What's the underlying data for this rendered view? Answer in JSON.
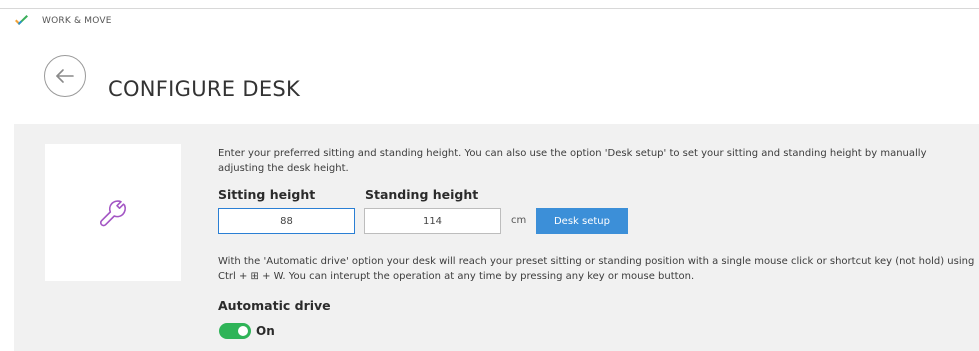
{
  "app": {
    "name": "WORK & MOVE",
    "logo_icon": "checkmark-logo-icon"
  },
  "header": {
    "back_icon": "arrow-left-icon",
    "title": "CONFIGURE DESK"
  },
  "panel": {
    "tool_icon": "wrench-icon",
    "description": "Enter your preferred sitting and standing height. You can also use the option 'Desk setup' to set your sitting and standing height by manually adjusting the desk height.",
    "sitting": {
      "label": "Sitting height",
      "value": "88"
    },
    "standing": {
      "label": "Standing height",
      "value": "114"
    },
    "unit": "cm",
    "desk_setup_label": "Desk setup",
    "auto_description": "With the 'Automatic drive' option your desk will reach your preset sitting or standing position with a single mouse click or shortcut key (not hold) using Ctrl + ⊞ + W. You can interupt the operation at any time by pressing any key or mouse button.",
    "automatic_drive": {
      "label": "Automatic drive",
      "state": "On",
      "enabled": true
    }
  },
  "colors": {
    "accent_blue": "#3c8fd8",
    "toggle_green": "#2fb458",
    "wrench_purple": "#a356c4",
    "panel_bg": "#f1f1f1"
  }
}
